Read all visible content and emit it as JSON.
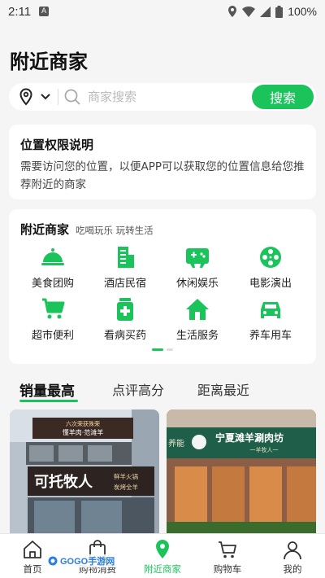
{
  "status_bar": {
    "time": "2:11",
    "battery_pct": "100%",
    "icons": [
      "location-icon",
      "wifi-icon",
      "battery-icon"
    ]
  },
  "page": {
    "title": "附近商家"
  },
  "search": {
    "placeholder": "商家搜索",
    "button_label": "搜索"
  },
  "permission_card": {
    "title": "位置权限说明",
    "text": "需要访问您的位置，以便APP可以获取您的位置信息给您推荐附近的商家"
  },
  "categories_card": {
    "title": "附近商家",
    "subtitle": "吃喝玩乐 玩转生活",
    "items": [
      {
        "label": "美食团购",
        "icon": "food-cloche-icon"
      },
      {
        "label": "酒店民宿",
        "icon": "hotel-building-icon"
      },
      {
        "label": "休闲娱乐",
        "icon": "gamepad-icon"
      },
      {
        "label": "电影演出",
        "icon": "film-reel-icon"
      },
      {
        "label": "超市便利",
        "icon": "shopping-cart-icon"
      },
      {
        "label": "看病买药",
        "icon": "medicine-icon"
      },
      {
        "label": "生活服务",
        "icon": "home-service-icon"
      },
      {
        "label": "养车用车",
        "icon": "car-icon"
      }
    ],
    "page_indicator": {
      "current": 1,
      "total": 2
    }
  },
  "sort_tabs": [
    {
      "label": "销量最高",
      "active": true
    },
    {
      "label": "点评高分",
      "active": false
    },
    {
      "label": "距离最近",
      "active": false
    }
  ],
  "shops": [
    {
      "sign_text": "可托牧人",
      "sign_side_1": "鲜羊火锅",
      "sign_side_2": "炭烤全羊",
      "top_banner": "六次荣获殊荣",
      "top_banner_2": "懂羊肉·范滩羊"
    },
    {
      "sign_text": "宁夏滩羊涮肉坊",
      "sign_sub": "一羊牧人一",
      "side_text": "养能"
    }
  ],
  "bottom_nav": [
    {
      "label": "首页",
      "icon": "home-icon",
      "active": false
    },
    {
      "label": "购物消费",
      "icon": "shopping-bag-icon",
      "active": false
    },
    {
      "label": "附近商家",
      "icon": "location-pin-icon",
      "active": true
    },
    {
      "label": "购物车",
      "icon": "cart-icon",
      "active": false
    },
    {
      "label": "我的",
      "icon": "user-icon",
      "active": false
    }
  ],
  "watermark": {
    "text": "GOGO手游网"
  },
  "colors": {
    "accent": "#1bc45b",
    "background": "#f5f5f5",
    "card": "#ffffff"
  }
}
